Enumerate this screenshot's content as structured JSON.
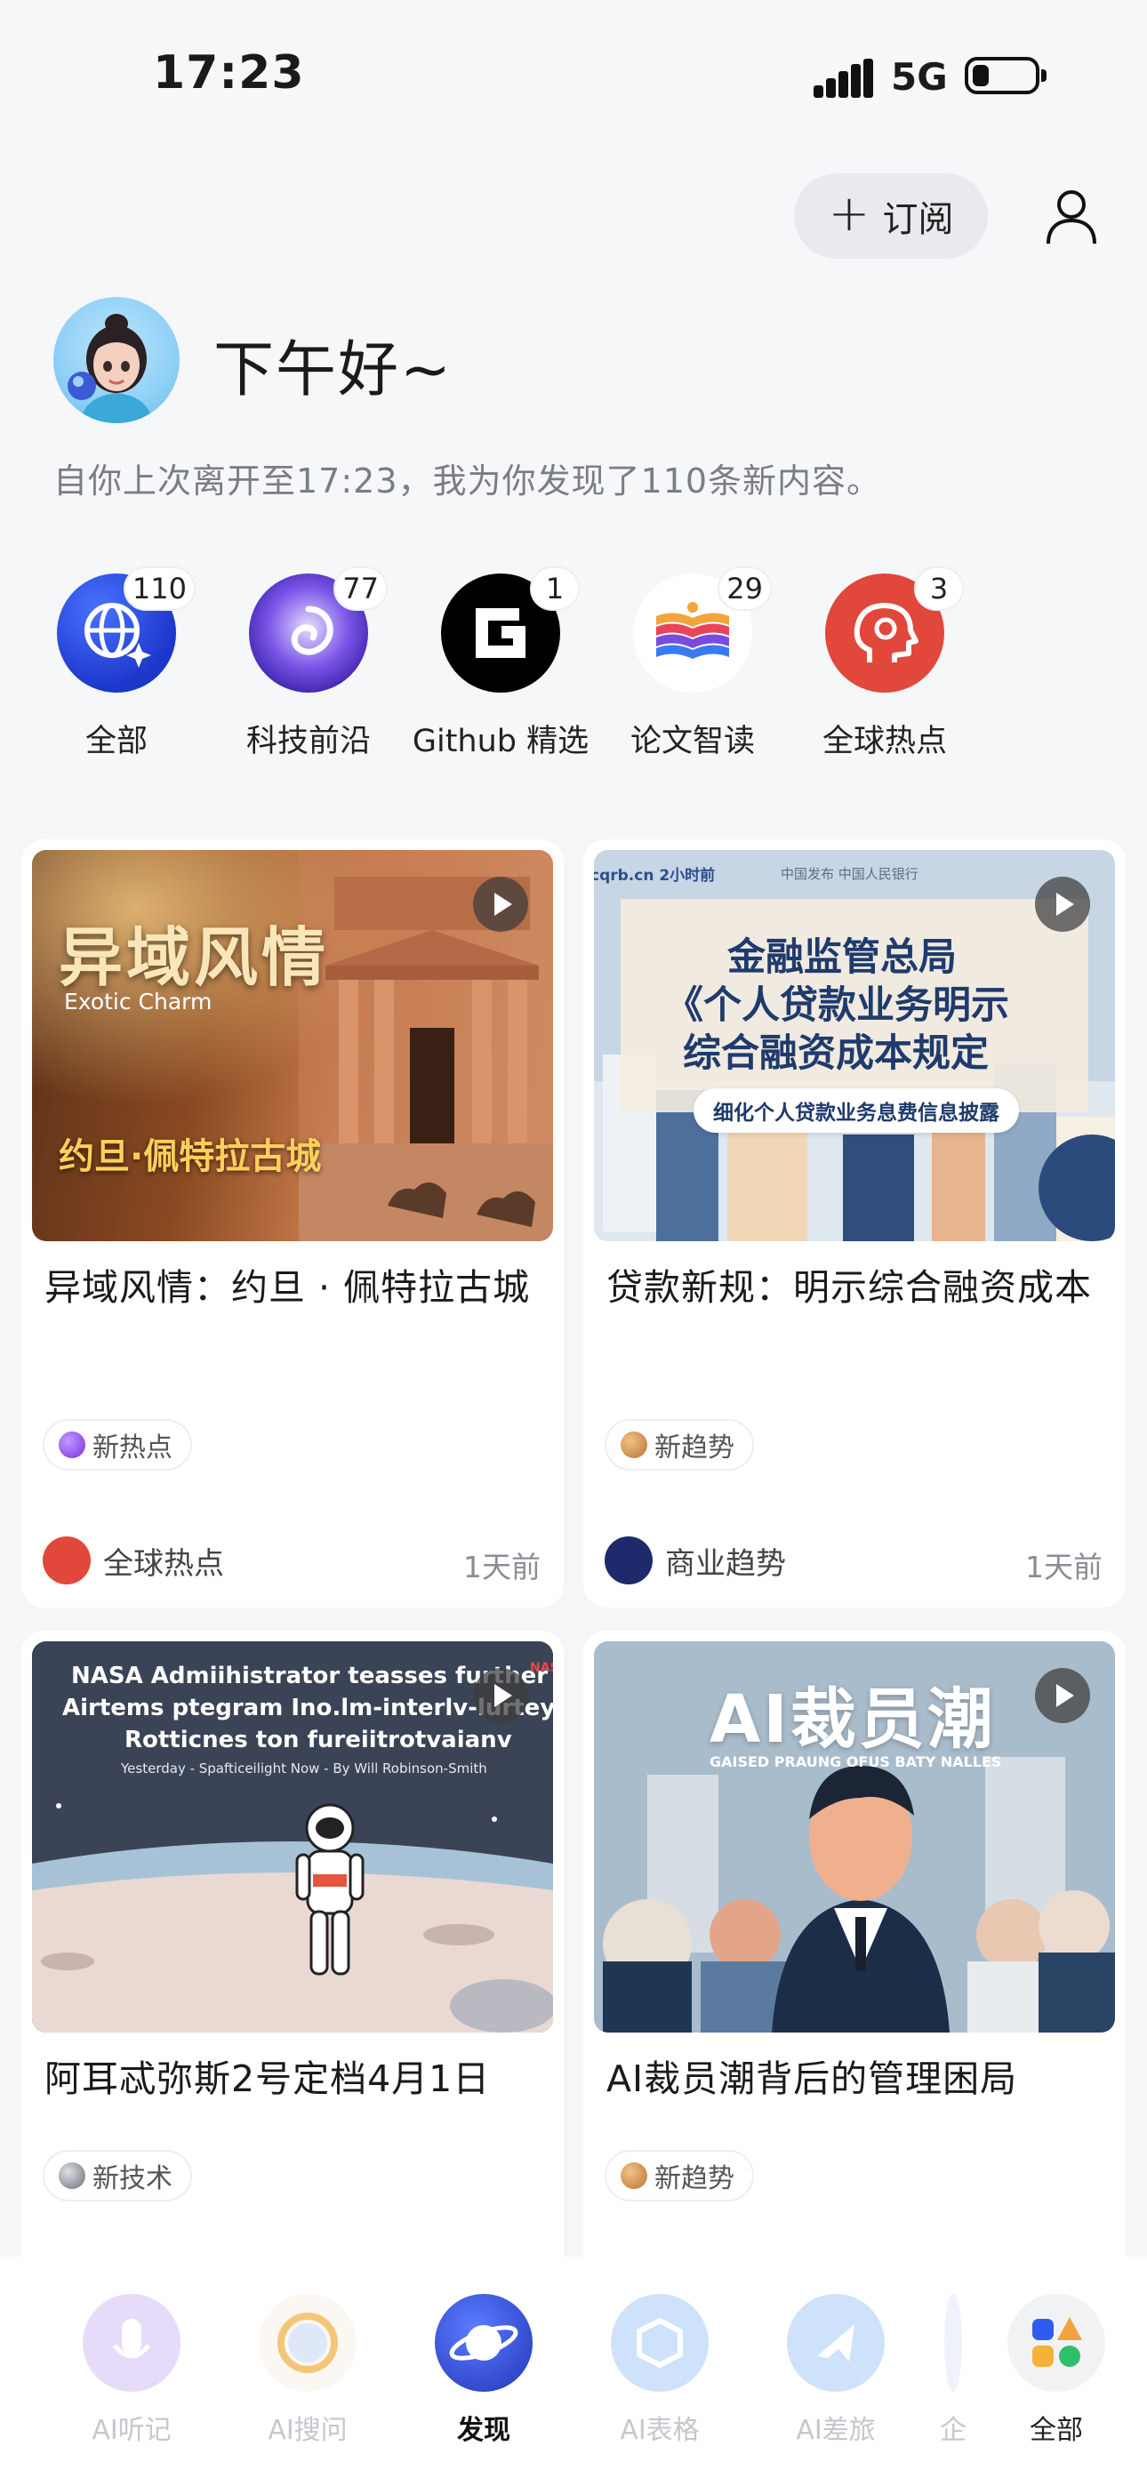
{
  "status_bar": {
    "time": "17:23",
    "network": "5G"
  },
  "header": {
    "subscribe_label": "订阅"
  },
  "greeting": {
    "title": "下午好~",
    "summary": "自你上次离开至17:23，我为你发现了110条新内容。"
  },
  "channels": [
    {
      "label": "全部",
      "count": "110"
    },
    {
      "label": "科技前沿",
      "count": "77"
    },
    {
      "label": "Github 精选",
      "count": "1"
    },
    {
      "label": "论文智读",
      "count": "29"
    },
    {
      "label": "全球热点",
      "count": "3"
    }
  ],
  "cards": [
    {
      "title": "异域风情：约旦 · 佩特拉古城",
      "thumb": {
        "headline": "异域风情",
        "sub": "Exotic Charm",
        "caption": "约旦·佩特拉古城"
      },
      "tag": "新热点",
      "source": "全球热点",
      "time": "1天前"
    },
    {
      "title": "贷款新规：明示综合融资成本",
      "thumb": {
        "top_left": "cqrb.cn 2小时前",
        "top_mid": "中国发布 中国人民银行",
        "line1": "金融监管总局",
        "line2": "《个人贷款业务明示",
        "line3": "综合融资成本规定",
        "pill": "细化个人贷款业务息费信息披露"
      },
      "tag": "新趋势",
      "source": "商业趋势",
      "time": "1天前"
    },
    {
      "title": "阿耳忒弥斯2号定档4月1日",
      "thumb": {
        "line1": "NASA Admiihistrator teasses further",
        "line2": "Airtems ptegram Ino.lm-interlv-lurteylew,",
        "line3": "Rotticnes ton fureiitrotvaianv",
        "byline": "Yesterday - Spafticeilight Now - By Will Robinson-Smith",
        "corner": "NAS"
      },
      "tag": "新技术"
    },
    {
      "title": "AI裁员潮背后的管理困局",
      "thumb": {
        "headline": "AI裁员潮",
        "sub": "GAISED PRAUNG OFUS BATY NALLES"
      },
      "tag": "新趋势"
    }
  ],
  "bottom_nav": [
    {
      "label": "AI听记",
      "active": false
    },
    {
      "label": "AI搜问",
      "active": false
    },
    {
      "label": "发现",
      "active": true
    },
    {
      "label": "AI表格",
      "active": false
    },
    {
      "label": "AI差旅",
      "active": false
    },
    {
      "label": "企",
      "active": false
    },
    {
      "label": "全部",
      "active": false
    }
  ],
  "colors": {
    "accent_blue": "#2c4fd8",
    "tag_hot": "#8a3fe0",
    "source_red": "#e2473b",
    "source_navy": "#1e2a6b"
  }
}
